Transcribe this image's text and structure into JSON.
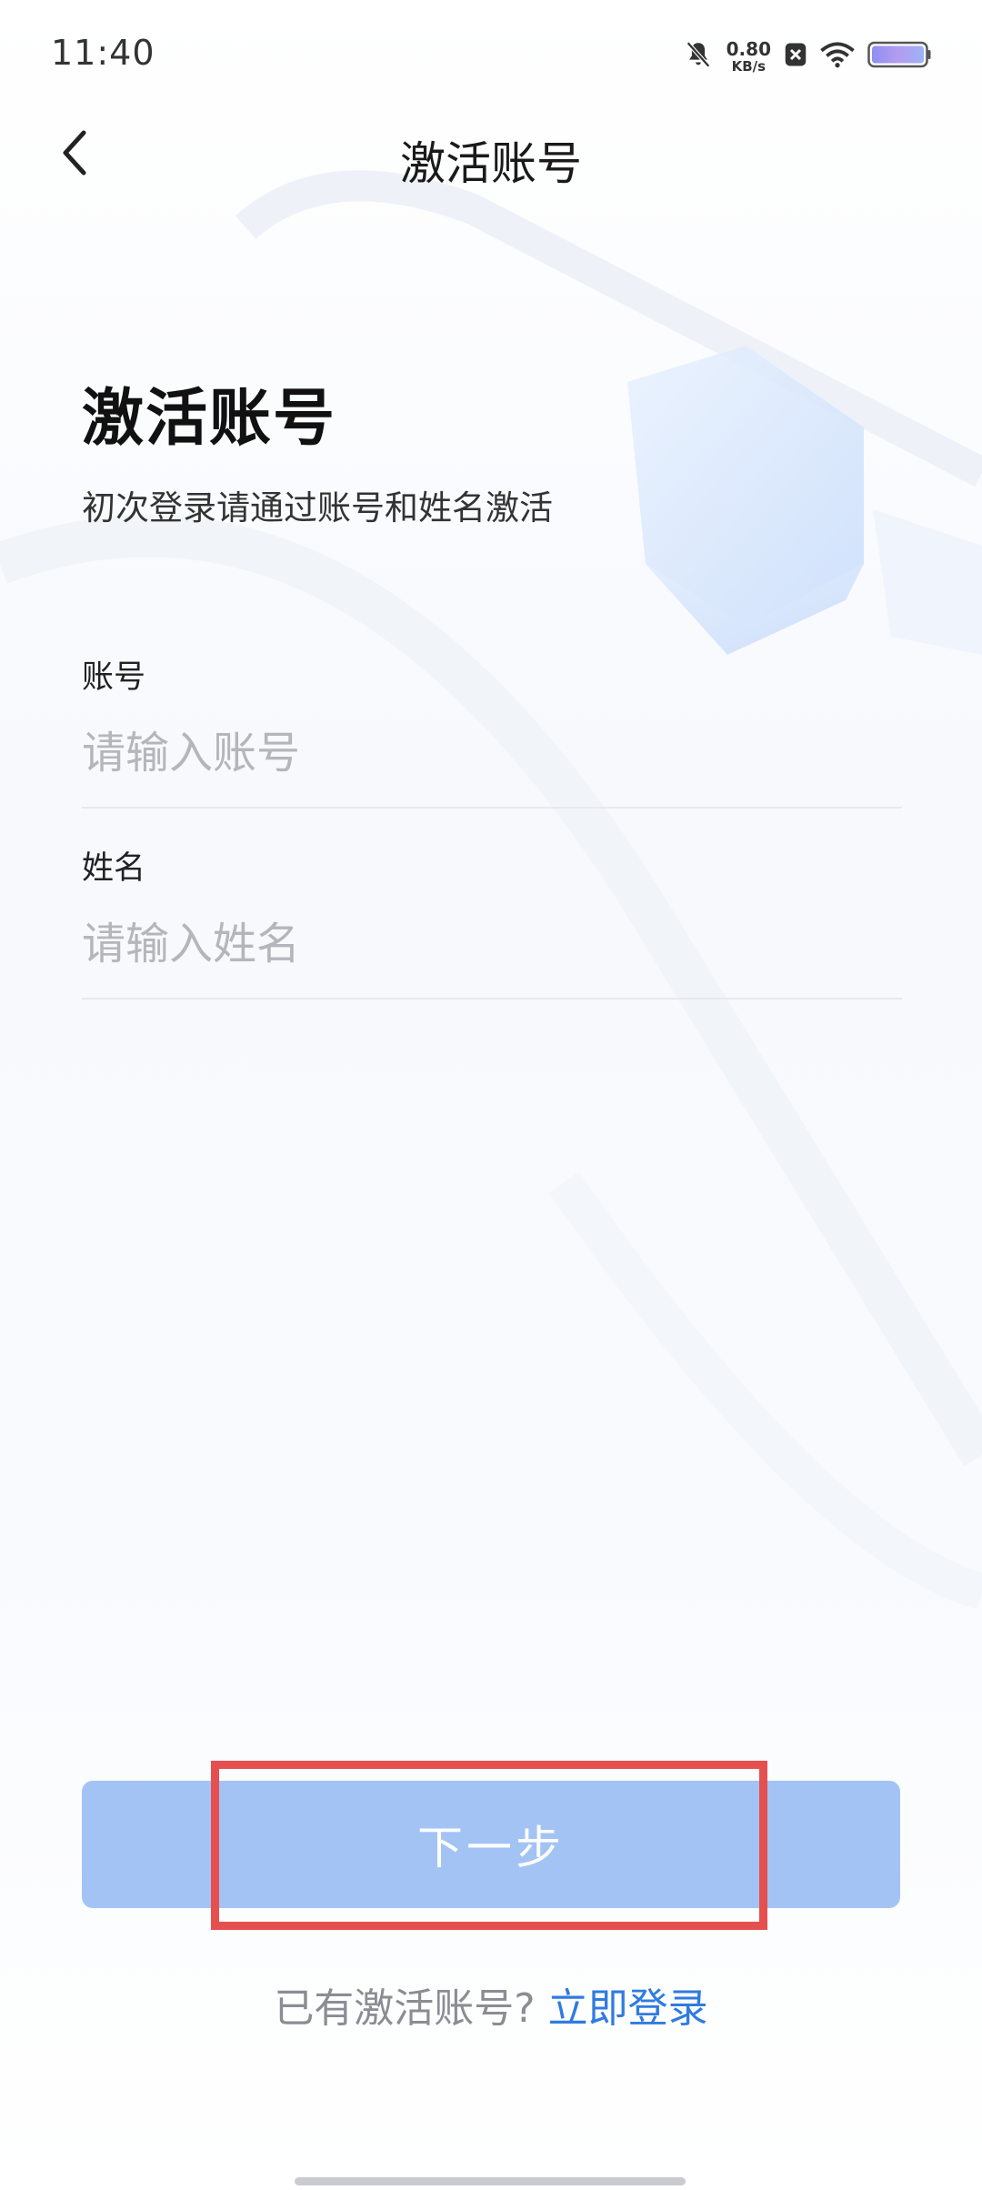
{
  "status_bar": {
    "time": "11:40",
    "net_speed_value": "0.80",
    "net_speed_unit": "KB/s",
    "icons": [
      "bell-muted-icon",
      "close-badge-icon",
      "wifi-icon",
      "battery-icon"
    ]
  },
  "nav": {
    "title": "激活账号",
    "back_icon": "chevron-left-icon"
  },
  "main": {
    "heading": "激活账号",
    "subtitle": "初次登录请通过账号和姓名激活",
    "fields": [
      {
        "label": "账号",
        "placeholder": "请输入账号",
        "value": ""
      },
      {
        "label": "姓名",
        "placeholder": "请输入姓名",
        "value": ""
      }
    ],
    "next_button_label": "下一步",
    "login_prompt": "已有激活账号?",
    "login_link": "立即登录"
  },
  "colors": {
    "button_bg": "#a3c3f5",
    "link": "#2f7be0",
    "highlight": "#e5504f"
  }
}
